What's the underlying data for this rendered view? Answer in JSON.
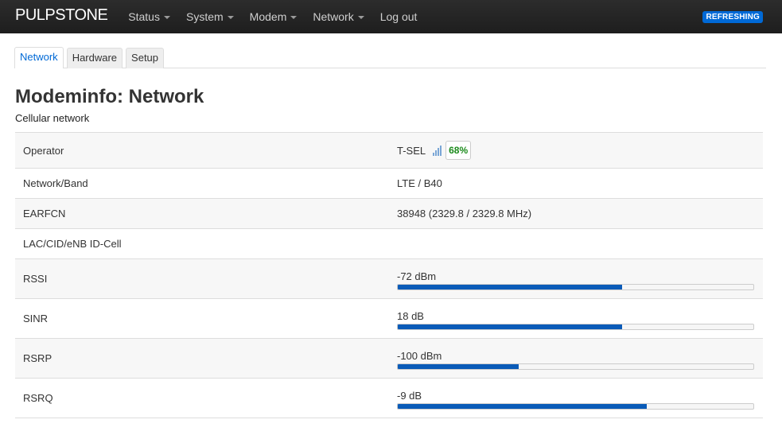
{
  "app": {
    "brand": "PULPSTONE",
    "status_badge": "REFRESHING"
  },
  "nav": [
    {
      "label": "Status",
      "dropdown": true
    },
    {
      "label": "System",
      "dropdown": true
    },
    {
      "label": "Modem",
      "dropdown": true
    },
    {
      "label": "Network",
      "dropdown": true
    },
    {
      "label": "Log out",
      "dropdown": false
    }
  ],
  "tabs": [
    {
      "label": "Network",
      "active": true
    },
    {
      "label": "Hardware",
      "active": false
    },
    {
      "label": "Setup",
      "active": false
    }
  ],
  "page": {
    "title": "Modeminfo: Network",
    "subtitle": "Cellular network"
  },
  "rows": {
    "operator": {
      "label": "Operator",
      "value": "T-SEL",
      "signal_icon": "signal-bars-icon",
      "signal_pct": "68%"
    },
    "band": {
      "label": "Network/Band",
      "value": "LTE / B40"
    },
    "earfcn": {
      "label": "EARFCN",
      "value": "38948 (2329.8 / 2329.8 MHz)"
    },
    "lac": {
      "label": "LAC/CID/eNB ID-Cell",
      "value": ""
    },
    "rssi": {
      "label": "RSSI",
      "value": "-72 dBm",
      "level": 0.63
    },
    "sinr": {
      "label": "SINR",
      "value": "18 dB",
      "level": 0.63
    },
    "rsrp": {
      "label": "RSRP",
      "value": "-100 dBm",
      "level": 0.34
    },
    "rsrq": {
      "label": "RSRQ",
      "value": "-9 dB",
      "level": 0.7
    }
  },
  "colors": {
    "accent": "#0069d6",
    "bar_fill": "#0a5bb8",
    "good": "#1a8a1a"
  }
}
